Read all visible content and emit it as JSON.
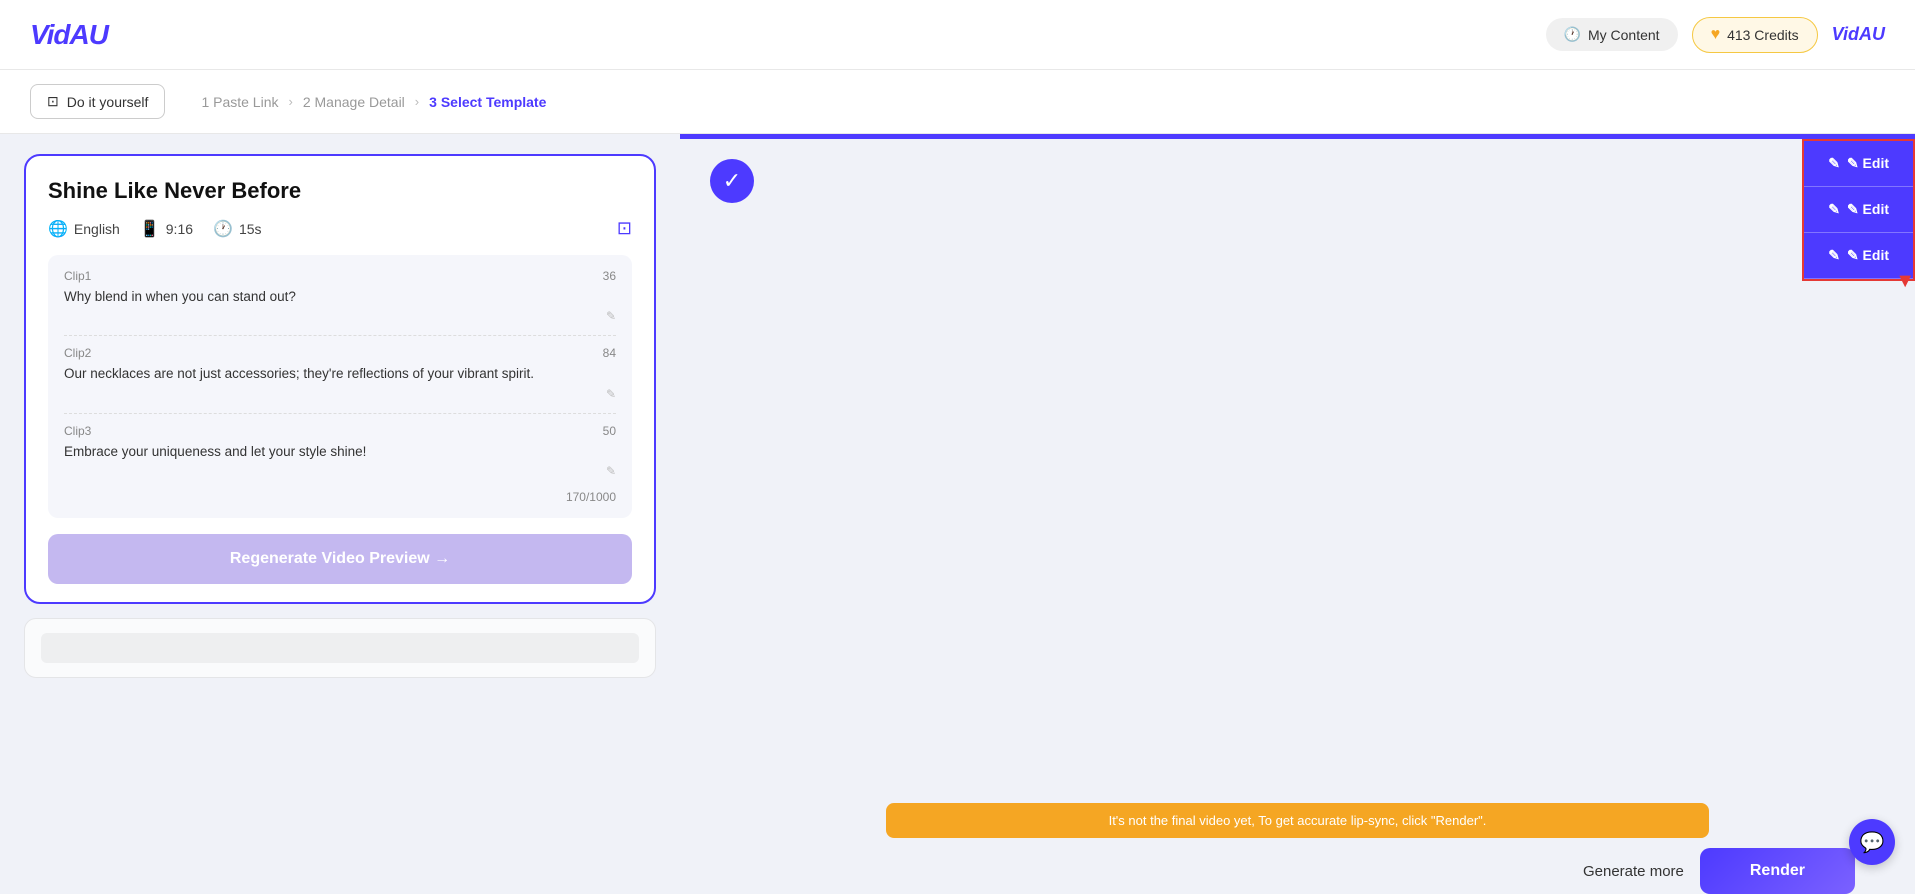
{
  "header": {
    "logo": "VidAU",
    "my_content_label": "My Content",
    "credits_label": "413 Credits",
    "header_logo": "VidAU"
  },
  "breadcrumb": {
    "diy_label": "Do it yourself",
    "step1": "1 Paste Link",
    "step2": "2 Manage Detail",
    "step3": "3 Select Template"
  },
  "card": {
    "title": "Shine Like Never Before",
    "lang": "English",
    "ratio": "9:16",
    "duration": "15s",
    "clips": [
      {
        "name": "Clip1",
        "char_count": "36",
        "text": "Why blend in when you can stand out?"
      },
      {
        "name": "Clip2",
        "char_count": "84",
        "text": "Our necklaces are not just accessories; they're reflections of your vibrant spirit."
      },
      {
        "name": "Clip3",
        "char_count": "50",
        "text": "Embrace your uniqueness and let your style shine!"
      }
    ],
    "total_chars": "170/1000",
    "regen_label": "Regenerate Video Preview →"
  },
  "edit_buttons": {
    "edit1": "✎ Edit",
    "edit2": "✎ Edit",
    "edit3": "✎ Edit"
  },
  "bottom": {
    "warning": "It's not the final video yet, To get accurate lip-sync, click \"Render\".",
    "generate_more": "Generate more",
    "render": "Render"
  },
  "chat_icon": "💬"
}
